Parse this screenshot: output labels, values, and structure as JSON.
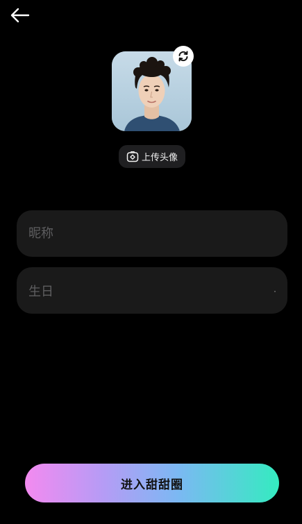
{
  "header": {
    "back_icon": "arrow-left-icon"
  },
  "avatar": {
    "refresh_icon": "refresh-icon",
    "upload_icon": "camera-icon",
    "upload_label": "上传头像"
  },
  "form": {
    "nickname_placeholder": "昵称",
    "nickname_value": "",
    "birthday_placeholder": "生日"
  },
  "footer": {
    "submit_label": "进入甜甜圈"
  },
  "colors": {
    "background": "#000000",
    "field_bg": "#1a1a1a",
    "placeholder": "#5e5e60",
    "gradient": [
      "#f38af0",
      "#7cb8f3",
      "#34ebc0"
    ]
  }
}
